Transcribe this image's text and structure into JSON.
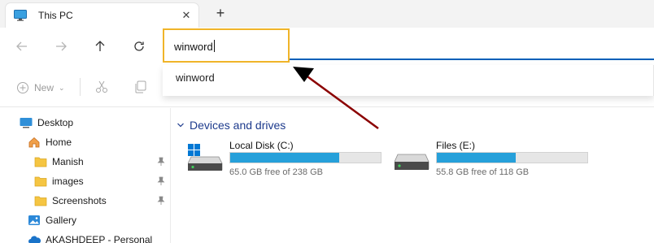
{
  "tab": {
    "title": "This PC",
    "close_glyph": "✕",
    "new_tab_glyph": "+",
    "icon": "monitor-icon"
  },
  "nav": {
    "back_icon": "arrow-left-icon",
    "forward_icon": "arrow-right-icon",
    "up_icon": "arrow-up-icon",
    "refresh_icon": "refresh-icon",
    "address_value": "winword"
  },
  "suggestions": [
    "winword"
  ],
  "cmdbar": {
    "new_label": "New",
    "new_chevron": "⌄"
  },
  "sidebar": {
    "items": [
      {
        "label": "Desktop",
        "icon": "desktop-icon",
        "pinned": false
      },
      {
        "label": "Home",
        "icon": "home-icon",
        "pinned": false
      },
      {
        "label": "Manish",
        "icon": "folder-icon",
        "pinned": true
      },
      {
        "label": "images",
        "icon": "folder-icon",
        "pinned": true
      },
      {
        "label": "Screenshots",
        "icon": "folder-icon",
        "pinned": true
      },
      {
        "label": "Gallery",
        "icon": "gallery-icon",
        "pinned": false
      },
      {
        "label": "AKASHDEEP - Personal",
        "icon": "cloud-icon",
        "pinned": false
      }
    ]
  },
  "main": {
    "section_title": "Devices and drives",
    "drives": [
      {
        "name": "Local Disk (C:)",
        "free_text": "65.0 GB free of 238 GB",
        "used_fraction": 0.727,
        "icon": "windows-drive-icon"
      },
      {
        "name": "Files (E:)",
        "free_text": "55.8 GB free of 118 GB",
        "used_fraction": 0.527,
        "icon": "drive-icon"
      }
    ]
  },
  "colors": {
    "accent": "#005fb8",
    "highlight_border": "#f0b429",
    "annotation_arrow": "#8b0000",
    "drive_fill": "#26a0da",
    "section_title": "#1c3a8c"
  }
}
